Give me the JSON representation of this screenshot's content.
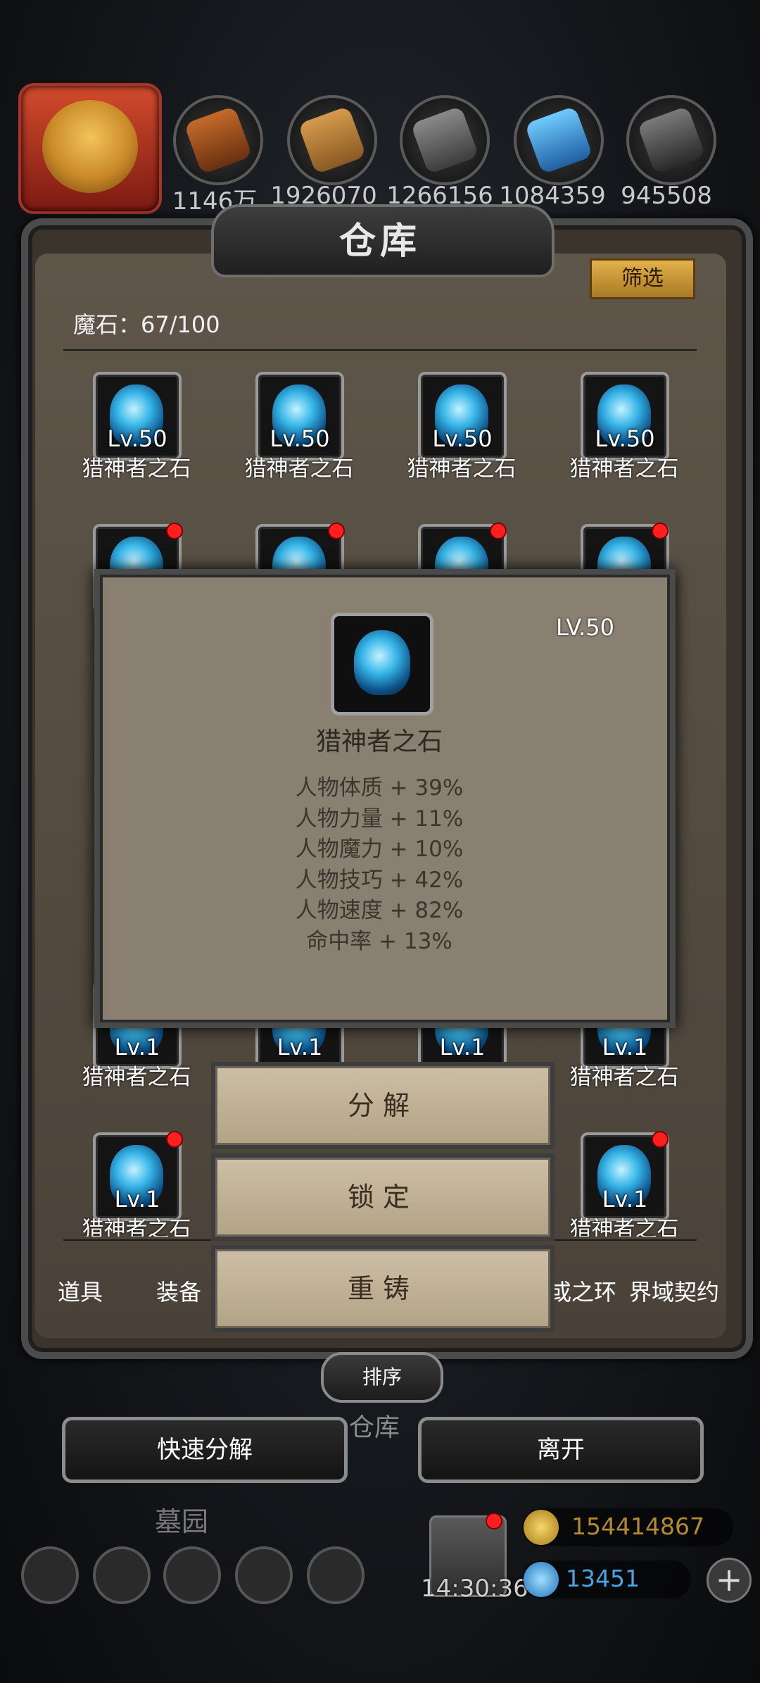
{
  "resources": {
    "values": [
      "1146万",
      "1926070",
      "1266156",
      "1084359",
      "945508"
    ]
  },
  "warehouse": {
    "title": "仓库",
    "filter_label": "筛选",
    "mostone_label": "魔石：67/100"
  },
  "items": [
    {
      "level": "Lv.50",
      "name": "猎神者之石"
    },
    {
      "level": "Lv.50",
      "name": "猎神者之石"
    },
    {
      "level": "Lv.50",
      "name": "猎神者之石"
    },
    {
      "level": "Lv.50",
      "name": "猎神者之石"
    },
    {
      "level": "Lv.1",
      "name": "猎神者之石"
    },
    {
      "level": "Lv.1",
      "name": "猎神者之石"
    },
    {
      "level": "Lv.1",
      "name": "猎神者之石"
    },
    {
      "level": "Lv.1",
      "name": "猎神者之石"
    },
    {
      "level": "Lv.1",
      "name": "猎神者之石"
    },
    {
      "level": "Lv.1",
      "name": "猎神者之石"
    }
  ],
  "popup": {
    "level": "LV.50",
    "name": "猎神者之石",
    "stats": [
      "人物体质 + 39%",
      "人物力量 + 11%",
      "人物魔力 + 10%",
      "人物技巧 + 42%",
      "人物速度 + 82%",
      "命中率 + 13%"
    ]
  },
  "actions": {
    "decompose": "分解",
    "lock": "锁定",
    "recast": "重铸"
  },
  "tabs": [
    "道具",
    "装备",
    "或之环",
    "界域契约"
  ],
  "bottom": {
    "sort": "排序",
    "warehouse_label": "仓库",
    "quick_decompose": "快速分解",
    "leave": "离开",
    "tomb": "墓园",
    "clock": "14:30:36",
    "gold": "154414867",
    "gems": "13451"
  }
}
